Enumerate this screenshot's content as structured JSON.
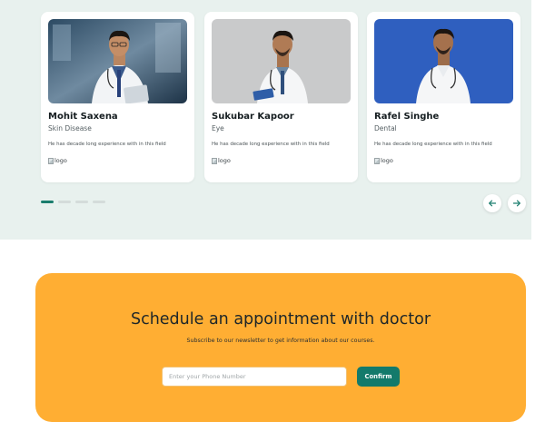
{
  "doctors": [
    {
      "name": "Mohit Saxena",
      "specialty": "Skin Disease",
      "description": "He has decade long experience with in this field",
      "logo_alt": "logo"
    },
    {
      "name": "Sukubar Kapoor",
      "specialty": "Eye",
      "description": "He has decade long experience with in this field",
      "logo_alt": "logo"
    },
    {
      "name": "Rafel Singhe",
      "specialty": "Dental",
      "description": "He has decade long experience with in this field",
      "logo_alt": "logo"
    }
  ],
  "carousel": {
    "slide_count": 4,
    "active_slide": 1,
    "prev_icon": "arrow-left-icon",
    "next_icon": "arrow-right-icon"
  },
  "appointment": {
    "title": "Schedule an appointment with doctor",
    "subtitle": "Subscribe to our newsletter to get information about our courses.",
    "phone_placeholder": "Enter your Phone Number",
    "phone_value": "",
    "confirm_label": "Confirm"
  },
  "colors": {
    "accent": "#137a6b",
    "cta_background": "#ffae33",
    "section_background": "#e8f1ee"
  }
}
